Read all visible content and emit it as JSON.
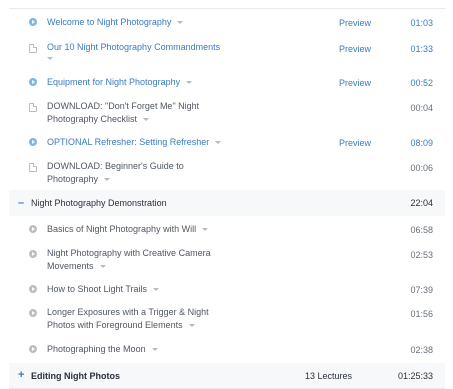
{
  "lectures_top": [
    {
      "title": "Welcome to Night Photography",
      "title2": "",
      "icon": "play-icon",
      "preview": "Preview",
      "duration": "01:03",
      "linked": true
    },
    {
      "title": "Our 10 Night Photography Commandments",
      "title2": "",
      "icon": "document-icon",
      "preview": "Preview",
      "duration": "01:33",
      "linked": true
    },
    {
      "title": "Equipment for Night Photography",
      "title2": "",
      "icon": "play-icon",
      "preview": "Preview",
      "duration": "00:52",
      "linked": true
    },
    {
      "title": "DOWNLOAD: \"Don't Forget Me\" Night",
      "title2": "Photography Checklist",
      "icon": "document-icon",
      "preview": "",
      "duration": "00:04",
      "linked": false
    },
    {
      "title": "OPTIONAL Refresher: Setting Refresher",
      "title2": "",
      "icon": "play-icon",
      "preview": "Preview",
      "duration": "08:09",
      "linked": true
    },
    {
      "title": "DOWNLOAD: Beginner's Guide to",
      "title2": "Photography",
      "icon": "document-icon",
      "preview": "",
      "duration": "00:06",
      "linked": false
    }
  ],
  "section_demo": {
    "toggle": "–",
    "title": "Night Photography Demonstration",
    "duration": "22:04"
  },
  "lectures_demo": [
    {
      "title": "Basics of Night Photography with Will",
      "title2": "",
      "icon": "play-icon",
      "duration": "06:58"
    },
    {
      "title": "Night Photography with Creative Camera",
      "title2": "Movements",
      "icon": "play-icon",
      "duration": "02:53"
    },
    {
      "title": "How to Shoot Light Trails",
      "title2": "",
      "icon": "play-icon",
      "duration": "07:39"
    },
    {
      "title": "Longer Exposures with a Trigger & Night",
      "title2": "Photos with Foreground Elements",
      "icon": "play-icon",
      "duration": "01:56"
    },
    {
      "title": "Photographing the Moon",
      "title2": "",
      "icon": "play-icon",
      "duration": "02:38"
    }
  ],
  "section_edit": {
    "toggle": "+",
    "title": "Editing Night Photos",
    "count": "13 Lectures",
    "duration": "01:25:33"
  },
  "colors": {
    "link": "#3a7bbf",
    "text": "#505763",
    "section_bg": "#f7f8fa",
    "border": "#e8e9eb"
  }
}
